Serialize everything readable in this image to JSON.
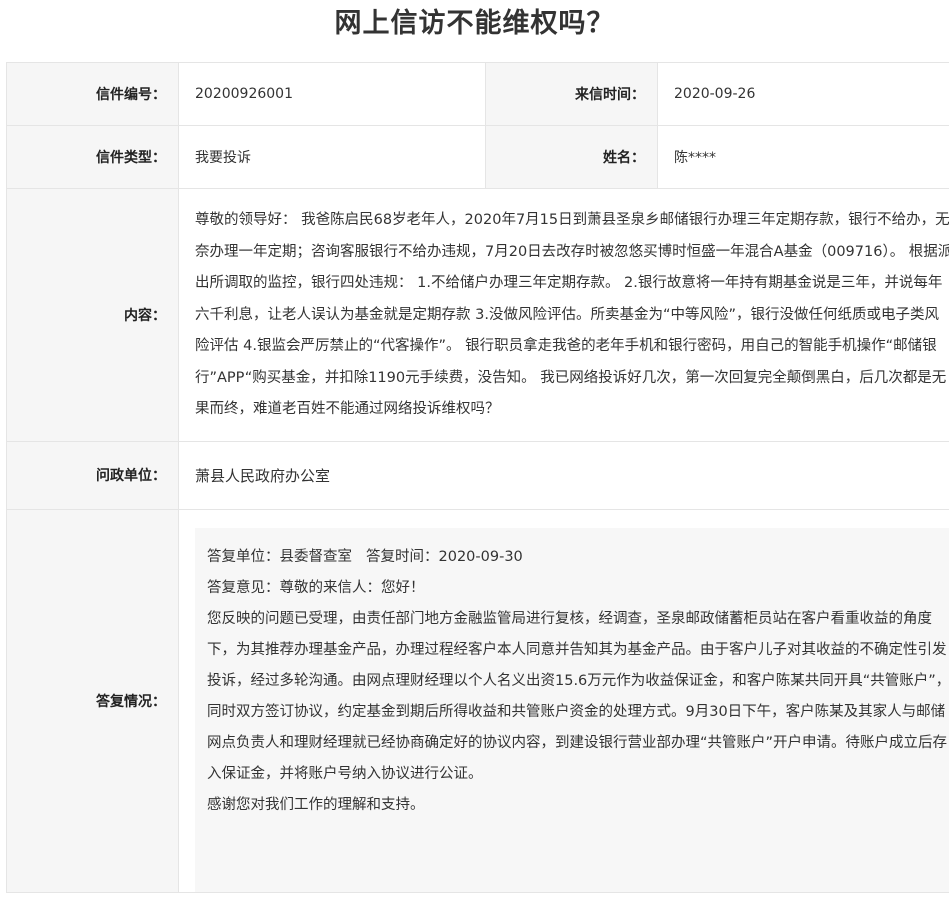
{
  "page_title": "网上信访不能维权吗？",
  "labels": {
    "letter_no": "信件编号：",
    "letter_time": "来信时间：",
    "letter_type": "信件类型：",
    "name": "姓名：",
    "content": "内容：",
    "agency": "问政单位：",
    "reply": "答复情况："
  },
  "values": {
    "letter_no": "20200926001",
    "letter_time": "2020-09-26",
    "letter_type": "我要投诉",
    "name": "陈****",
    "content": "尊敬的领导好： 我爸陈启民68岁老年人，2020年7月15日到萧县圣泉乡邮储银行办理三年定期存款，银行不给办，无奈办理一年定期；咨询客服银行不给办违规，7月20日去改存时被忽悠买博时恒盛一年混合A基金（009716）。 根据派出所调取的监控，银行四处违规： 1.不给储户办理三年定期存款。 2.银行故意将一年持有期基金说是三年，并说每年六千利息，让老人误认为基金就是定期存款 3.没做风险评估。所卖基金为“中等风险”，银行没做任何纸质或电子类风险评估 4.银监会严厉禁止的“代客操作”。 银行职员拿走我爸的老年手机和银行密码，用自己的智能手机操作“邮储银行”APP“购买基金，并扣除1190元手续费，没告知。 我已网络投诉好几次，第一次回复完全颠倒黑白，后几次都是无果而终，难道老百姓不能通过网络投诉维权吗？",
    "agency": "萧县人民政府办公室"
  },
  "reply": {
    "unit_label": "答复单位：县委督查室",
    "time_label": "答复时间：2020-09-30",
    "opinion": "答复意见：尊敬的来信人：您好！",
    "body": "您反映的问题已受理，由责任部门地方金融监管局进行复核，经调查，圣泉邮政储蓄柜员站在客户看重收益的角度下，为其推荐办理基金产品，办理过程经客户本人同意并告知其为基金产品。由于客户儿子对其收益的不确定性引发投诉，经过多轮沟通。由网点理财经理以个人名义出资15.6万元作为收益保证金，和客户陈某共同开具“共管账户”，同时双方签订协议，约定基金到期后所得收益和共管账户资金的处理方式。9月30日下午，客户陈某及其家人与邮储网点负责人和理财经理就已经协商确定好的协议内容，到建设银行营业部办理“共管账户”开户申请。待账户成立后存入保证金，并将账户号纳入协议进行公证。",
    "thanks": "感谢您对我们工作的理解和支持。"
  }
}
